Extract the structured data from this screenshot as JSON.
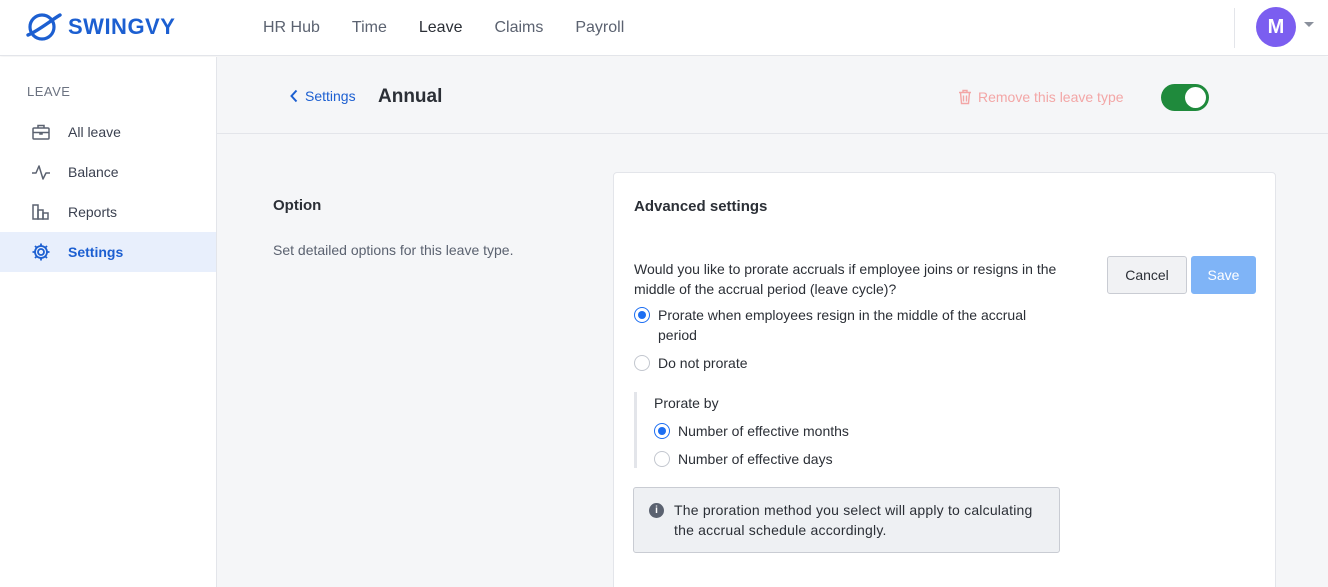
{
  "app": {
    "brand": "SWINGVY",
    "avatar_initial": "M"
  },
  "topnav": {
    "items": [
      {
        "label": "HR Hub"
      },
      {
        "label": "Time"
      },
      {
        "label": "Leave"
      },
      {
        "label": "Claims"
      },
      {
        "label": "Payroll"
      }
    ]
  },
  "sidebar": {
    "heading": "LEAVE",
    "items": [
      {
        "label": "All leave",
        "icon": "briefcase-icon"
      },
      {
        "label": "Balance",
        "icon": "activity-icon"
      },
      {
        "label": "Reports",
        "icon": "bar-chart-icon"
      },
      {
        "label": "Settings",
        "icon": "gear-icon"
      }
    ]
  },
  "header": {
    "back_label": "Settings",
    "title": "Annual",
    "remove_label": "Remove this leave type",
    "toggle_on": true
  },
  "option": {
    "title": "Option",
    "description": "Set detailed options for this leave type."
  },
  "card": {
    "title": "Advanced settings",
    "question": "Would you like to prorate accruals if employee joins or resigns in the middle of the accrual period (leave cycle)?",
    "cancel_label": "Cancel",
    "save_label": "Save",
    "options": [
      {
        "label": "Prorate when employees resign in the middle of the accrual period",
        "checked": true
      },
      {
        "label": "Do not prorate",
        "checked": false
      }
    ],
    "prorate_by": {
      "title": "Prorate by",
      "options": [
        {
          "label": "Number of effective months",
          "checked": true
        },
        {
          "label": "Number of effective days",
          "checked": false
        }
      ]
    },
    "info": "The proration method you select will apply to calculating the accrual schedule accordingly."
  },
  "colors": {
    "brand": "#1c5fd1",
    "toggle": "#1f8a3c",
    "avatar": "#7b5ef0",
    "remove": "#f3a6a6"
  }
}
